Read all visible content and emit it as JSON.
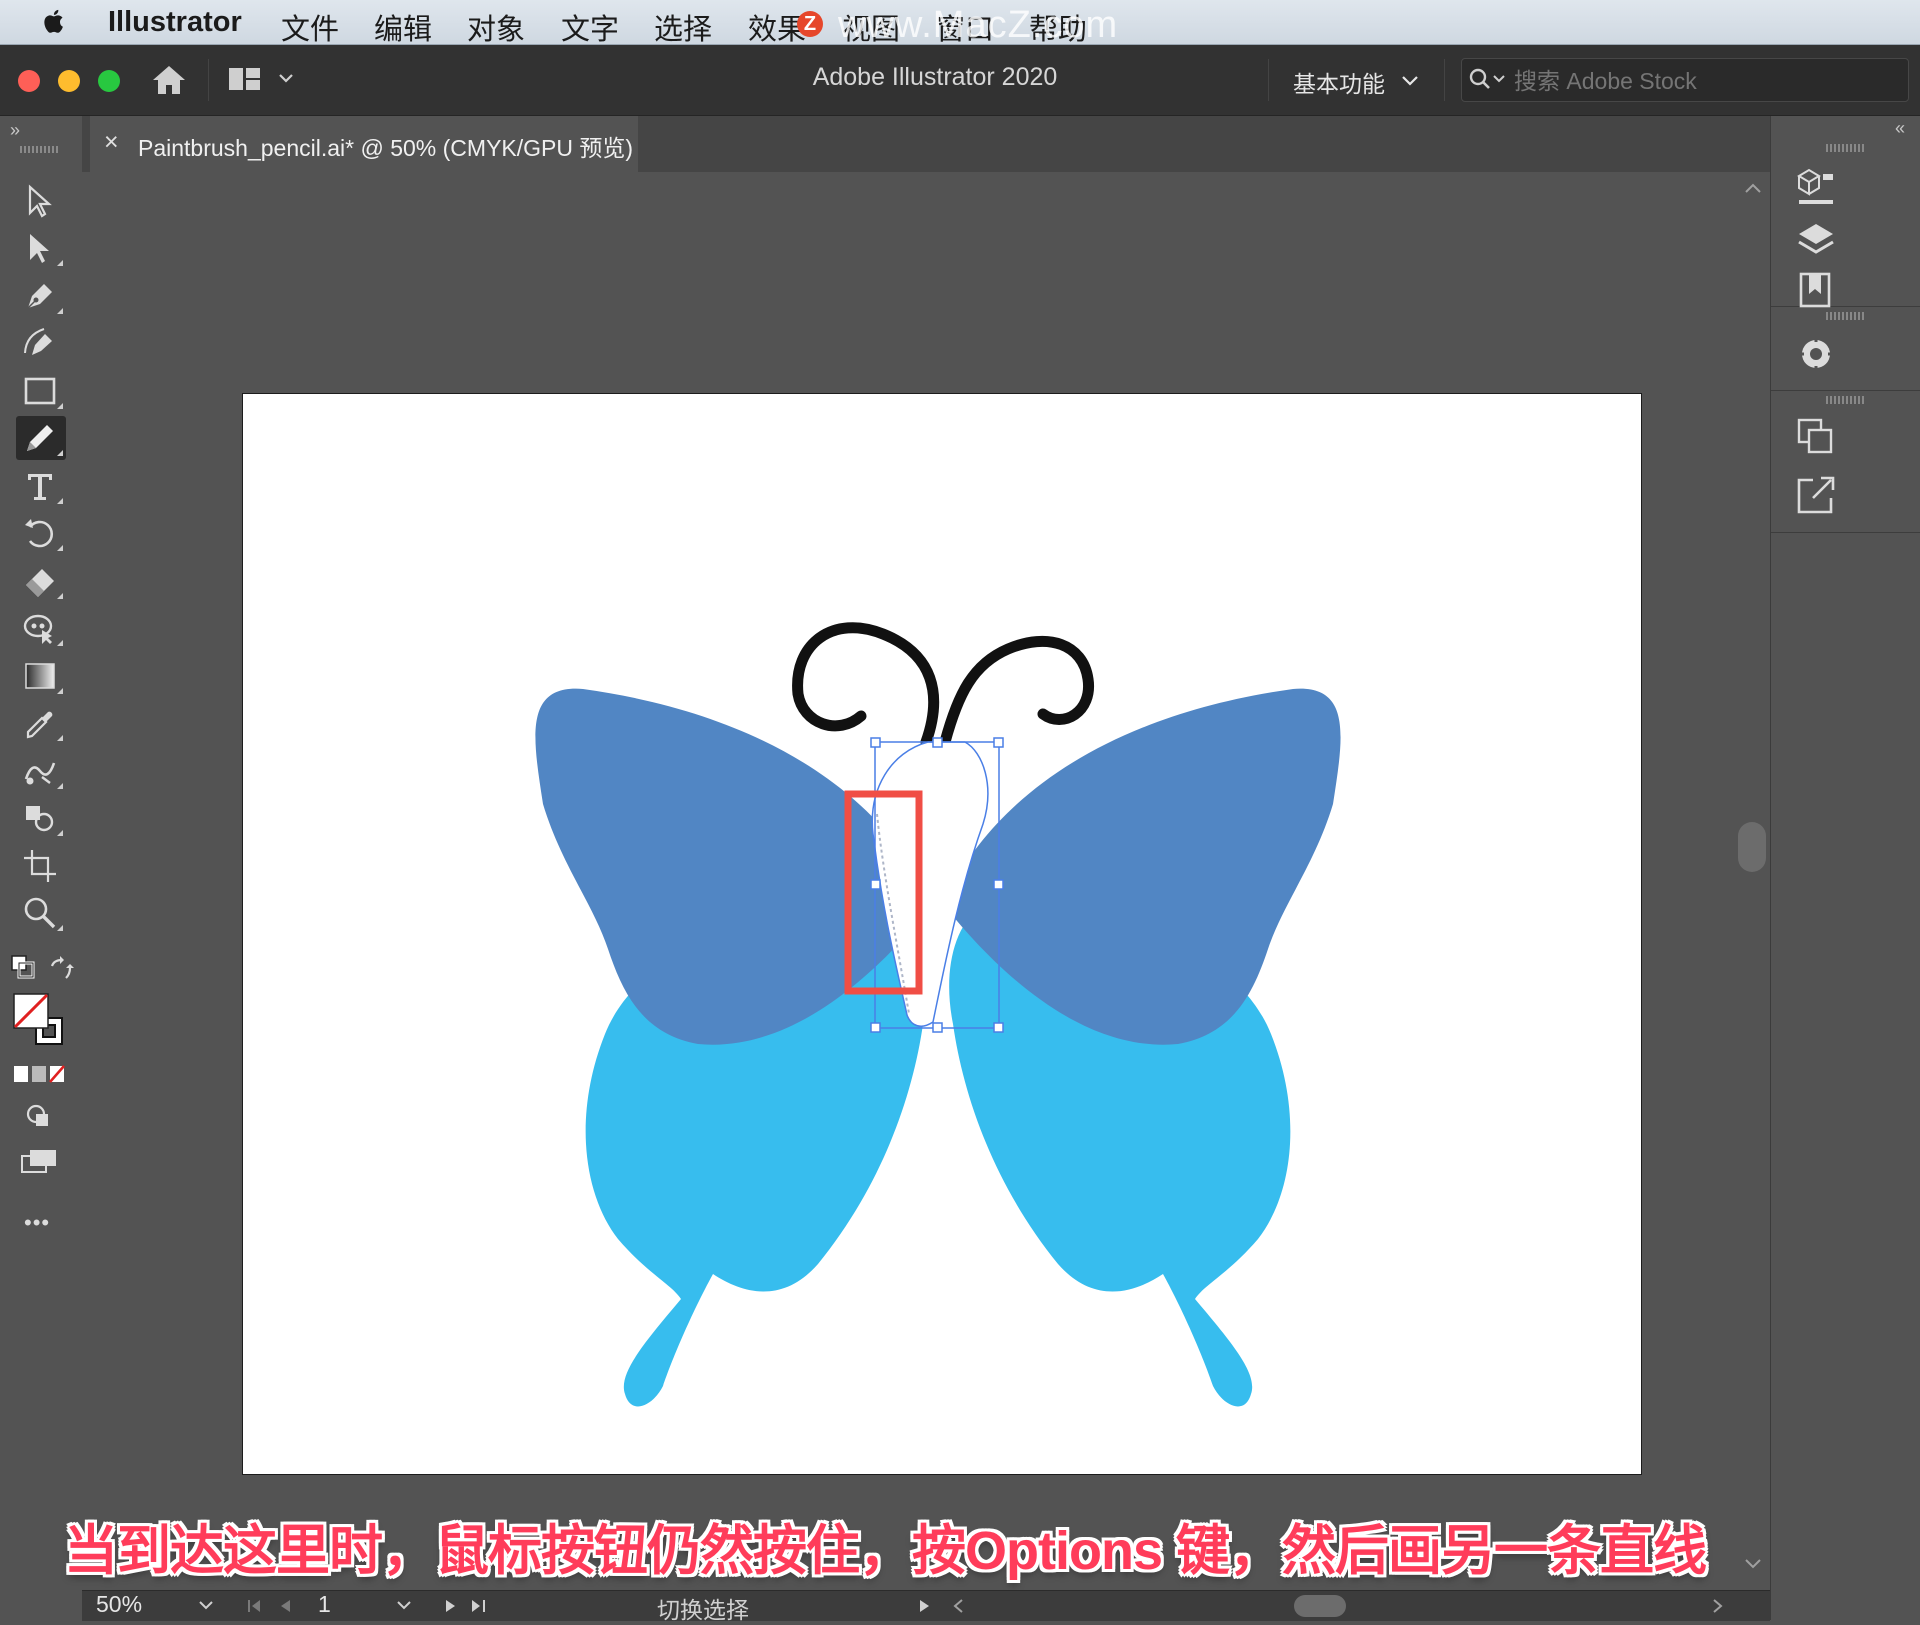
{
  "menubar": {
    "app_name": "Illustrator",
    "items": [
      "文件",
      "编辑",
      "对象",
      "文字",
      "选择",
      "效果",
      "视图",
      "窗口",
      "帮助"
    ],
    "watermark": "www.MacZ.com",
    "watermark_badge": "Z"
  },
  "appbar": {
    "title": "Adobe Illustrator 2020",
    "workspace": "基本功能",
    "search_placeholder": "搜索 Adobe Stock"
  },
  "document_tab": {
    "close": "×",
    "name": "Paintbrush_pencil.ai* @ 50% (CMYK/GPU 预览)"
  },
  "tools": [
    {
      "name": "selection-tool"
    },
    {
      "name": "direct-selection-tool"
    },
    {
      "name": "pen-tool"
    },
    {
      "name": "curvature-tool"
    },
    {
      "name": "rectangle-tool"
    },
    {
      "name": "pencil-tool",
      "active": true
    },
    {
      "name": "type-tool"
    },
    {
      "name": "rotate-tool"
    },
    {
      "name": "eraser-tool"
    },
    {
      "name": "puppet-warp-tool"
    },
    {
      "name": "gradient-tool"
    },
    {
      "name": "eyedropper-tool"
    },
    {
      "name": "blend-tool"
    },
    {
      "name": "shape-builder-tool"
    },
    {
      "name": "artboard-tool"
    },
    {
      "name": "zoom-tool"
    }
  ],
  "toolbar_more": "•••",
  "caption": "当到达这里时，鼠标按钮仍然按住，按Options 键，然后画另一条直线",
  "statusbar": {
    "zoom": "50%",
    "page": "1",
    "status": "切换选择"
  },
  "colors": {
    "wing_upper": "#5186c4",
    "wing_lower": "#37bdee",
    "selection": "#4a7fe6",
    "highlight": "#f04e45",
    "caption": "#ff3c5a"
  }
}
